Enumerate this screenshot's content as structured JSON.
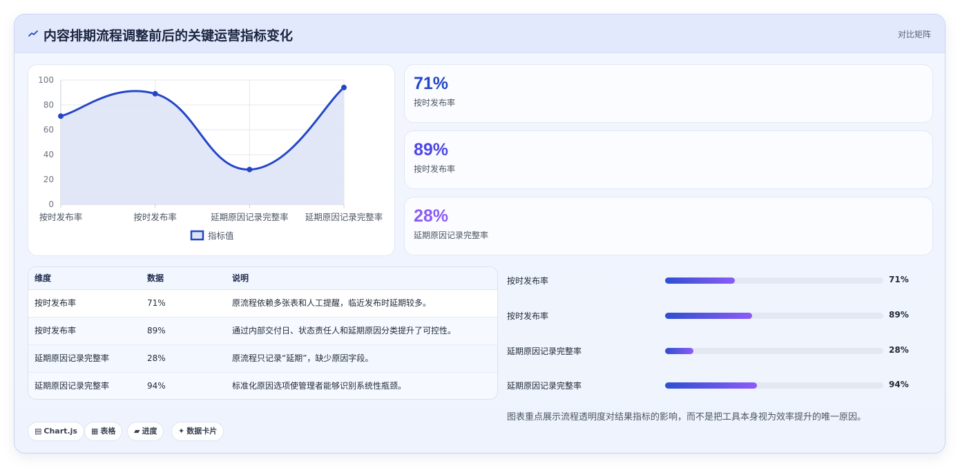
{
  "header": {
    "title": "内容排期流程调整前后的关键运营指标变化",
    "tag": "对比矩阵",
    "icon": "trend-line-icon"
  },
  "chart_data": {
    "type": "line",
    "categories": [
      "按时发布率",
      "按时发布率",
      "延期原因记录完整率",
      "延期原因记录完整率"
    ],
    "series": [
      {
        "name": "指标值",
        "values": [
          71,
          89,
          28,
          94
        ]
      }
    ],
    "yticks": [
      "0",
      "20",
      "40",
      "60",
      "80",
      "100"
    ],
    "ylim": [
      0,
      100
    ],
    "grid": true,
    "fill": true,
    "smooth": true,
    "legend": "bottom",
    "colors": {
      "line": "#2446c6",
      "fill": "#dde3f7"
    }
  },
  "stats": [
    {
      "value": "71%",
      "label": "按时发布率",
      "color": "#2446c6"
    },
    {
      "value": "89%",
      "label": "按时发布率",
      "color": "#4f46e5"
    },
    {
      "value": "28%",
      "label": "延期原因记录完整率",
      "color": "#8b5cf6"
    }
  ],
  "table": {
    "headers": [
      "维度",
      "数据",
      "说明"
    ],
    "rows": [
      [
        "按时发布率",
        "71%",
        "原流程依赖多张表和人工提醒，临近发布时延期较多。"
      ],
      [
        "按时发布率",
        "89%",
        "通过内部交付日、状态责任人和延期原因分类提升了可控性。"
      ],
      [
        "延期原因记录完整率",
        "28%",
        "原流程只记录“延期”，缺少原因字段。"
      ],
      [
        "延期原因记录完整率",
        "94%",
        "标准化原因选项使管理者能够识别系统性瓶颈。"
      ]
    ]
  },
  "progress": [
    {
      "label": "按时发布率",
      "value": "71%",
      "fraction": 0.32
    },
    {
      "label": "按时发布率",
      "value": "89%",
      "fraction": 0.4
    },
    {
      "label": "延期原因记录完整率",
      "value": "28%",
      "fraction": 0.13
    },
    {
      "label": "延期原因记录完整率",
      "value": "94%",
      "fraction": 0.42
    }
  ],
  "note": "图表重点展示流程透明度对结果指标的影响，而不是把工具本身视为效率提升的唯一原因。",
  "chips": [
    {
      "icon": "chart-icon",
      "glyph": "▤",
      "label": "Chart.js"
    },
    {
      "icon": "table-icon",
      "glyph": "▦",
      "label": "表格"
    },
    {
      "icon": "progress-icon",
      "glyph": "▰",
      "label": "进度"
    },
    {
      "icon": "sparkle-icon",
      "glyph": "✦",
      "label": "数据卡片"
    }
  ]
}
